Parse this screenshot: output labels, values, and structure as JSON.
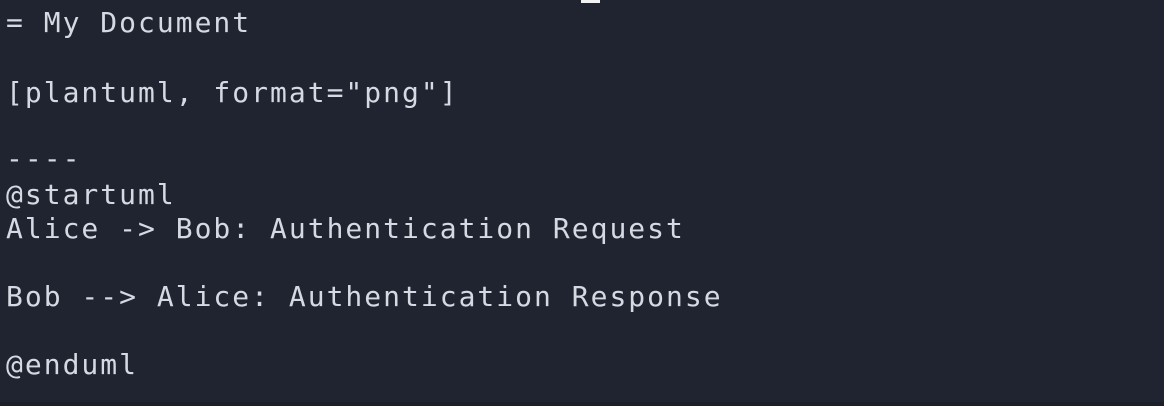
{
  "editor": {
    "lines": [
      "= My Document",
      "[plantuml, format=\"png\"]",
      "----",
      "@startuml",
      "Alice -> Bob: Authentication Request",
      "Bob --> Alice: Authentication Response",
      "@enduml"
    ]
  },
  "colors": {
    "background": "#1f2430",
    "text": "#d4d9e2",
    "cursor": "#f2f2f2"
  }
}
